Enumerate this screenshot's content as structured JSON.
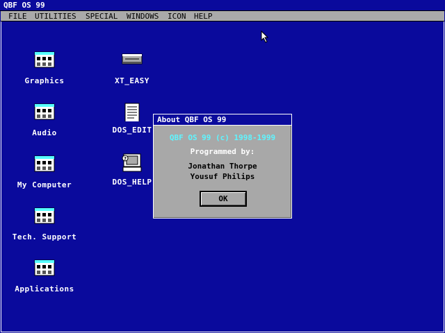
{
  "window": {
    "title": "QBF OS 99"
  },
  "menu": [
    "FILE",
    "UTILITIES",
    "SPECIAL",
    "WINDOWS",
    "ICON",
    "HELP"
  ],
  "desktop": {
    "left_icons": [
      {
        "label": "Graphics",
        "icon": "app-grid-icon"
      },
      {
        "label": "Audio",
        "icon": "app-grid-icon"
      },
      {
        "label": "My Computer",
        "icon": "app-grid-icon"
      },
      {
        "label": "Tech. Support",
        "icon": "app-grid-icon"
      },
      {
        "label": "Applications",
        "icon": "app-grid-icon"
      }
    ],
    "right_icons": [
      {
        "label": "XT_EASY",
        "icon": "drive-icon"
      },
      {
        "label": "DOS_EDIT",
        "icon": "document-icon"
      },
      {
        "label": "DOS_HELP",
        "icon": "computer-help-icon"
      }
    ]
  },
  "dialog": {
    "title": "About QBF OS 99",
    "heading": "QBF OS 99 (c) 1998-1999",
    "subheading": "Programmed by:",
    "names": [
      "Jonathan Thorpe",
      "Yousuf Philips"
    ],
    "ok_label": "OK"
  },
  "colors": {
    "desktop": "#0a0a9c",
    "menubar": "#aaaaaa",
    "dialog": "#a8a8a8",
    "heading_cyan": "#5ff5ff"
  }
}
